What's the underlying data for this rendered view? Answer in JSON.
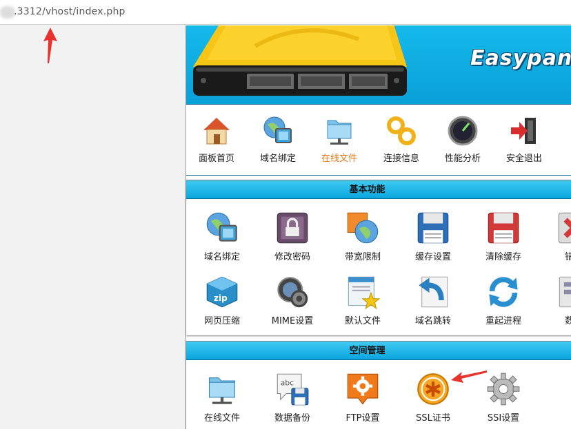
{
  "browser": {
    "url": ".3312/vhost/index.php"
  },
  "banner": {
    "logo": "Easypane"
  },
  "nav": [
    {
      "label": "面板首页",
      "icon": "home-icon"
    },
    {
      "label": "域名绑定",
      "icon": "domain-globe-icon"
    },
    {
      "label": "在线文件",
      "icon": "folder-network-icon",
      "active": true
    },
    {
      "label": "连接信息",
      "icon": "chain-link-icon"
    },
    {
      "label": "性能分析",
      "icon": "gauge-icon"
    },
    {
      "label": "安全退出",
      "icon": "exit-door-icon"
    }
  ],
  "basic": {
    "title": "基本功能",
    "row1": [
      "域名绑定",
      "修改密码",
      "带宽限制",
      "缓存设置",
      "清除缓存",
      "错误"
    ],
    "row2": [
      "网页压缩",
      "MIME设置",
      "默认文件",
      "域名跳转",
      "重起进程",
      "数据"
    ]
  },
  "space": {
    "title": "空间管理",
    "row1": [
      "在线文件",
      "数据备份",
      "FTP设置",
      "SSL证书",
      "SSI设置"
    ]
  },
  "colors": {
    "header_blue": "#0aa6de",
    "active_label": "#e07a18",
    "annotation_red": "#e8322e"
  }
}
